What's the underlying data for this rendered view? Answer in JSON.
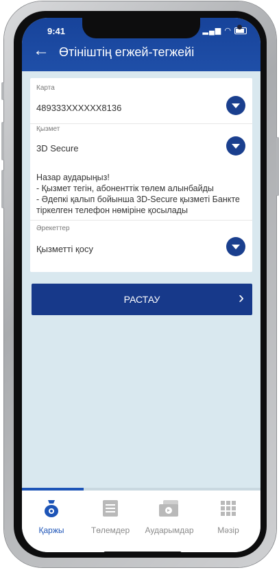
{
  "status_bar": {
    "time": "9:41"
  },
  "header": {
    "title": "Өтініштің егжей-тегжейі"
  },
  "form": {
    "card": {
      "label": "Карта",
      "value": "489333XXXXXX8136"
    },
    "service": {
      "label": "Қызмет",
      "value": "3D Secure"
    },
    "notice": [
      "Назар аударыңыз!",
      " - Қызмет тегін, абоненттік төлем алынбайды",
      " - Әдепкі қалып бойынша 3D-Secure қызметі Банкте",
      "тіркелген телефон нөміріне қосылады"
    ],
    "action": {
      "label": "Әрекеттер",
      "value": "Қызметті қосу"
    }
  },
  "confirm_button": {
    "label": "РАСТАУ"
  },
  "progress": {
    "fraction": 0.26
  },
  "tabs": [
    {
      "label": "Қаржы",
      "icon": "money-bag-icon",
      "active": true
    },
    {
      "label": "Төлемдер",
      "icon": "payments-list-icon",
      "active": false
    },
    {
      "label": "Аударымдар",
      "icon": "transfer-card-icon",
      "active": false
    },
    {
      "label": "Мәзір",
      "icon": "menu-grid-icon",
      "active": false
    }
  ],
  "colors": {
    "primary": "#1a3f8e",
    "accent": "#1d54b7",
    "background": "#d9e8ef"
  }
}
